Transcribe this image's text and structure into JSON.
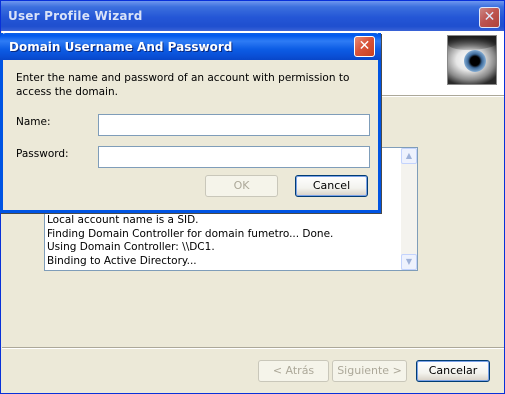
{
  "wizard": {
    "title": "User Profile Wizard",
    "close_glyph": "✕",
    "log_lines": [
      "Local account name is a SID.",
      "Finding Domain Controller for domain fumetro... Done.",
      "Using Domain Controller: \\\\DC1.",
      "Binding to Active Directory..."
    ],
    "scroll_up_glyph": "▲",
    "scroll_down_glyph": "▼",
    "back_label": "< Atrás",
    "next_label": "Siguiente >",
    "cancel_label": "Cancelar",
    "header_image": "eye-icon"
  },
  "dialog": {
    "title": "Domain Username And Password",
    "close_glyph": "✕",
    "description": "Enter the name and password of an account with permission to access the domain.",
    "name_label": "Name:",
    "name_value": "",
    "password_label": "Password:",
    "password_value": "",
    "ok_label": "OK",
    "ok_enabled": false,
    "cancel_label": "Cancel"
  },
  "colors": {
    "title_bar_active": "#0054e3",
    "window_face": "#ece9d8",
    "close_button": "#d9543a"
  }
}
